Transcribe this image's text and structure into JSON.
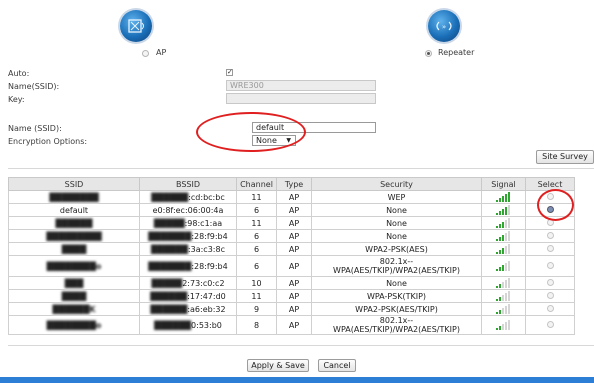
{
  "mode": {
    "ap_label": "AP",
    "repeater_label": "Repeater",
    "selected": "Repeater"
  },
  "form": {
    "auto_label": "Auto:",
    "auto_checked": true,
    "name_ssid_label": "Name(SSID):",
    "name_ssid_value": "WRE300",
    "key_label": "Key:",
    "key_value": "",
    "name_ssid2_label": "Name (SSID):",
    "name_ssid2_value": "default",
    "encryption_label": "Encryption Options:",
    "encryption_value": "None"
  },
  "site_survey_label": "Site Survey",
  "table": {
    "headers": [
      "SSID",
      "BSSID",
      "Channel",
      "Type",
      "Security",
      "Signal",
      "Select"
    ],
    "rows": [
      {
        "ssid": "████████",
        "bssid_hidden": "██████",
        "bssid_visible": ":cd:bc:bc",
        "channel": "11",
        "type": "AP",
        "security": "WEP",
        "signal": 5,
        "selected": false
      },
      {
        "ssid": "default",
        "bssid_hidden": "",
        "bssid_visible": "e0:8f:ec:06:00:4a",
        "channel": "6",
        "type": "AP",
        "security": "None",
        "signal": 4,
        "selected": true
      },
      {
        "ssid": "██████",
        "bssid_hidden": "█████",
        "bssid_visible": ":98:c1:aa",
        "channel": "11",
        "type": "AP",
        "security": "None",
        "signal": 3,
        "selected": false
      },
      {
        "ssid": "█████████",
        "bssid_hidden": "███████",
        "bssid_visible": ":28:f9:b4",
        "channel": "6",
        "type": "AP",
        "security": "None",
        "signal": 3,
        "selected": false
      },
      {
        "ssid": "████",
        "bssid_hidden": "██████",
        "bssid_visible": ":3a:c3:8c",
        "channel": "6",
        "type": "AP",
        "security": "WPA2-PSK(AES)",
        "signal": 3,
        "selected": false
      },
      {
        "ssid": "████████o",
        "bssid_hidden": "███████",
        "bssid_visible": ":28:f9:b4",
        "channel": "6",
        "type": "AP",
        "security": "802.1x--\nWPA(AES/TKIP)/WPA2(AES/TKIP)",
        "signal": 3,
        "selected": false
      },
      {
        "ssid": "███",
        "bssid_hidden": "█████",
        "bssid_visible": "2:73:c0:c2",
        "channel": "10",
        "type": "AP",
        "security": "None",
        "signal": 2,
        "selected": false
      },
      {
        "ssid": "████",
        "bssid_hidden": "██████",
        "bssid_visible": ":17:47:d0",
        "channel": "11",
        "type": "AP",
        "security": "WPA-PSK(TKIP)",
        "signal": 2,
        "selected": false
      },
      {
        "ssid": "██████K",
        "bssid_hidden": "██████",
        "bssid_visible": ":a6:eb:32",
        "channel": "9",
        "type": "AP",
        "security": "WPA2-PSK(AES/TKIP)",
        "signal": 2,
        "selected": false
      },
      {
        "ssid": "████████o",
        "bssid_hidden": "██████",
        "bssid_visible": "0:53:b0",
        "channel": "8",
        "type": "AP",
        "security": "802.1x--\nWPA(AES/TKIP)/WPA2(AES/TKIP)",
        "signal": 2,
        "selected": false
      }
    ]
  },
  "buttons": {
    "apply_save": "Apply & Save",
    "cancel": "Cancel"
  },
  "colors": {
    "annotation_red": "#e02020",
    "signal_green": "#2fa62f",
    "footer_blue": "#2d7fd6"
  }
}
